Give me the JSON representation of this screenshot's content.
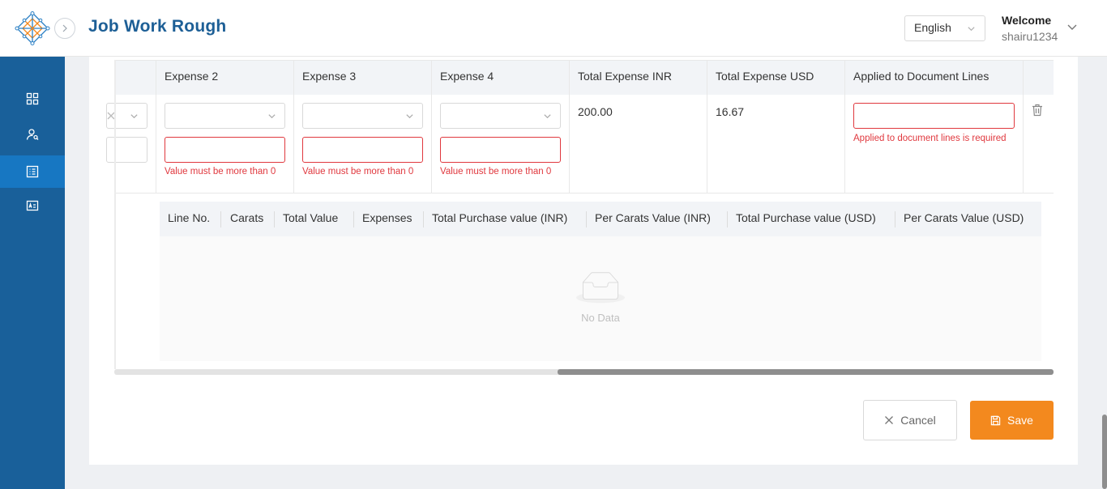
{
  "header": {
    "title": "Job Work Rough",
    "language": "English",
    "welcome": "Welcome",
    "username": "shairu1234"
  },
  "sidebar": {
    "items": [
      {
        "icon": "dashboard-grid-icon"
      },
      {
        "icon": "users-search-icon"
      },
      {
        "icon": "document-list-icon",
        "active": true
      },
      {
        "icon": "id-card-icon"
      }
    ]
  },
  "expense_table": {
    "columns": [
      "Expense 2",
      "Expense 3",
      "Expense 4",
      "Total Expense INR",
      "Total Expense USD",
      "Applied to Document Lines"
    ],
    "row": {
      "expense_error": "Value must be more than 0",
      "total_expense_inr": "200.00",
      "total_expense_usd": "16.67",
      "applied_error": "Applied to document lines is required"
    }
  },
  "lines_table": {
    "columns": [
      "Line No.",
      "Carats",
      "Total Value",
      "Expenses",
      "Total Purchase value (INR)",
      "Per Carats Value (INR)",
      "Total Purchase value (USD)",
      "Per Carats Value (USD)"
    ],
    "empty_text": "No Data"
  },
  "actions": {
    "cancel": "Cancel",
    "save": "Save"
  },
  "colors": {
    "brand": "#1d5f96",
    "sidebar": "#19609a",
    "sidebar_active": "#1777c2",
    "error": "#e0383e",
    "save": "#f3891e"
  }
}
